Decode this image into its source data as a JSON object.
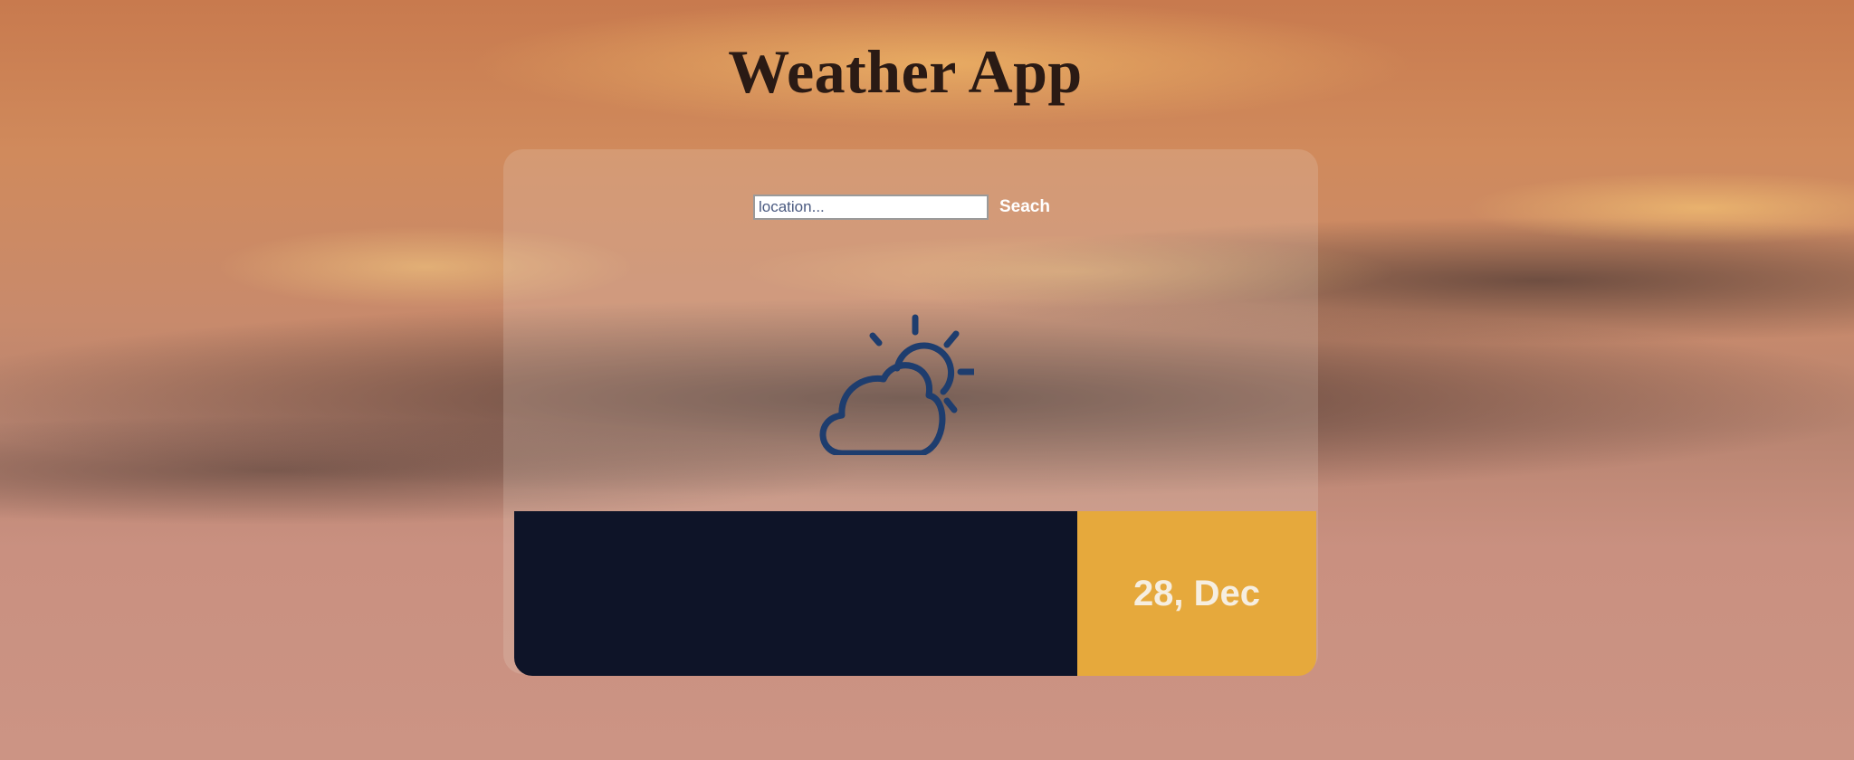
{
  "app": {
    "title": "Weather App"
  },
  "search": {
    "placeholder": "location...",
    "value": "",
    "button_label": "Seach"
  },
  "weather": {
    "icon": "partly-cloudy-icon"
  },
  "date": {
    "label": "28, Dec"
  },
  "colors": {
    "info_panel": "#0e1428",
    "date_panel": "#e6a93c",
    "icon_stroke": "#1e3d6e"
  }
}
